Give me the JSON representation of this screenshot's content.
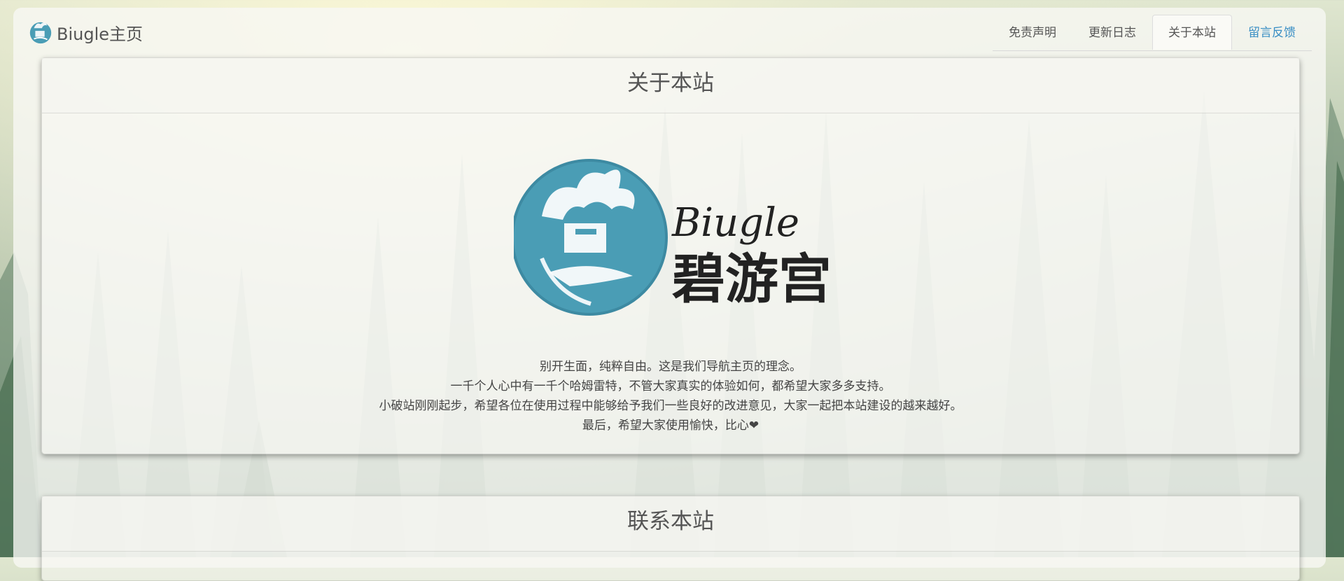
{
  "brand": {
    "name": "Biugle主页"
  },
  "nav": {
    "tabs": [
      {
        "label": "免责声明"
      },
      {
        "label": "更新日志"
      },
      {
        "label": "关于本站"
      },
      {
        "label": "留言反馈"
      }
    ],
    "active_index": 2
  },
  "about": {
    "title": "关于本站",
    "logo_text_en": "Biugle",
    "logo_text_cn": "碧游宫",
    "lines": [
      "别开生面，纯粹自由。这是我们导航主页的理念。",
      "一千个人心中有一千个哈姆雷特，不管大家真实的体验如何，都希望大家多多支持。",
      "小破站刚刚起步，希望各位在使用过程中能够给予我们一些良好的改进意见，大家一起把本站建设的越来越好。",
      "最后，希望大家使用愉快，比心❤"
    ]
  },
  "contact": {
    "title": "联系本站"
  },
  "colors": {
    "accent": "#3a8fc4",
    "logo_teal": "#4a9db5"
  }
}
